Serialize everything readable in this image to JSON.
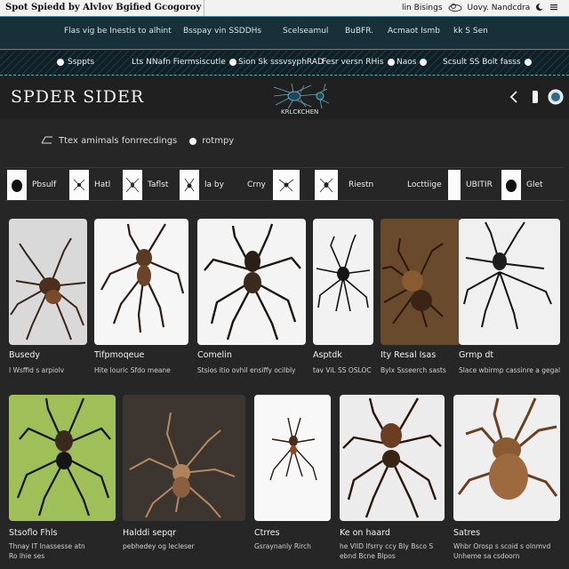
{
  "browser": {
    "site_title": "Spot Spiedd by Alvlov Bgified Gcogoroy",
    "right_text_1": "lin Bisings",
    "right_text_2": "Uovy. Nandcdra"
  },
  "nav_primary": [
    "Flas vig be Inestis to alhint",
    "Bsspay vin SSDDHs",
    "Scelseamul",
    "BuBFR.",
    "Acmaot Ismb",
    "kk S Sen"
  ],
  "nav_secondary": [
    "Ssppts",
    "Lts NNafn Fiermsiscutle",
    "Sion Sk  sssvsyphRAD",
    "Fesr versn RHis",
    "Naos",
    "Scsult SS Bolt fasss"
  ],
  "header": {
    "title": "SPDER SIDER",
    "logo_caption": "KRLCKCHEN"
  },
  "filter": {
    "text": "Ttex amimals fonrrecdings",
    "option": "rotmpy"
  },
  "tabs": [
    "Pbsulf",
    "Hatl",
    "Taflst",
    "la by",
    "Crny",
    "Riestn",
    "Locttiige",
    "UBITIR",
    "Glet"
  ],
  "cards": [
    {
      "name": "Busedy",
      "desc": [
        "I Wsffid s arpiolv",
        ""
      ]
    },
    {
      "name": "Tifpmoqeue",
      "desc": [
        "Hite louric Sfdo meane",
        ""
      ]
    },
    {
      "name": "Comelin",
      "desc": [
        "Stsios itio ovhil  ensiffy ocilbly",
        ""
      ]
    },
    {
      "name": "Asptdk",
      "desc": [
        "tav ViL SS OSLOC",
        ""
      ]
    },
    {
      "name": "Ity Resal Isas",
      "desc": [
        "Bylx  Ssseerch  sasts",
        ""
      ]
    },
    {
      "name": "Grmp dt",
      "desc": [
        "Slace wbirmp  cassinre  a gegal",
        ""
      ]
    },
    {
      "name": "Stsoflo Fhls",
      "desc": [
        "Thnay IT  Inassesse atn",
        "Ro lhie ses"
      ]
    },
    {
      "name": "Halddi sepqr",
      "desc": [
        "pebhedey  og lecleser",
        ""
      ]
    },
    {
      "name": "Ctrres",
      "desc": [
        "Gsraynanly Rirch",
        ""
      ]
    },
    {
      "name": "Ke on haard",
      "desc": [
        "he VIID Ifsrry  ccy Bly  Bsco S",
        "ebnd Bcne  Blpos"
      ]
    },
    {
      "name": "Satres",
      "desc": [
        "Whbr Orosp  s scoid s olnmvd",
        "Unheme sa  csdoorn"
      ]
    }
  ],
  "icons": {
    "back": "chevron-left-icon",
    "page": "page-icon",
    "globe": "globe-icon",
    "moon": "moon-icon",
    "cloud": "cloud-icon"
  },
  "colors": {
    "nav_bg": "#17303a",
    "accent": "#4d8898",
    "page_bg": "#262626"
  }
}
